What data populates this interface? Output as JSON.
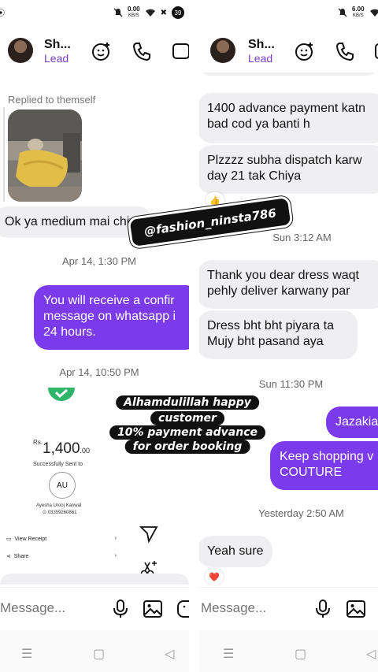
{
  "status": {
    "left_net": {
      "value": "0.00",
      "unit": "KB/S"
    },
    "left_badge": "39",
    "right_net": {
      "value": "6.00",
      "unit": "KB/S"
    }
  },
  "left": {
    "header": {
      "name": "Sh...",
      "label": "Lead"
    },
    "replied_note": "Replied to themself",
    "msg_medium": "Ok ya medium mai chiya",
    "ts1": "Apr 14, 1:30 PM",
    "sent_confirm_lines": [
      "You will receive a confir",
      "message on whatsapp i",
      "24 hours."
    ],
    "ts2": "Apr 14, 10:50 PM",
    "receipt": {
      "currency": "Rs.",
      "amount": "1,400",
      "decimals": ".00",
      "status": "Successfully Sent to",
      "initials": "AU",
      "recipient": "Ayesha Urooj Kanwal",
      "phone": "03359260861",
      "view_receipt": "View Receipt",
      "share": "Share"
    },
    "composer_placeholder": "Message..."
  },
  "right": {
    "header": {
      "name": "Sh...",
      "label": "Lead"
    },
    "msg1": [
      "1400 advance payment katn",
      "bad cod ya banti h"
    ],
    "msg2": [
      "Plzzzz subha dispatch karw",
      "day 21 tak Chiya"
    ],
    "reaction_thumb": "👍",
    "ts1": "Sun 3:12 AM",
    "msg3": [
      "Thank you dear dress waqt",
      "pehly deliver karwany par"
    ],
    "msg4": [
      "Dress bht bht piyara ta",
      "Mujy bht pasand aya"
    ],
    "ts2": "Sun 11:30 PM",
    "sent1": "Jazakia",
    "sent2": [
      "Keep shopping v",
      "COUTURE"
    ],
    "ts3": "Yesterday 2:50 AM",
    "msg5": "Yeah sure",
    "reaction_heart": "❤️",
    "composer_placeholder": "Message..."
  },
  "overlay": {
    "handle": "@fashion_ninsta786",
    "caption": [
      "Alhamdulillah happy",
      "customer",
      "10% payment advance",
      "for order booking"
    ]
  },
  "colors": {
    "accent": "#7c3aed",
    "lead": "#7a3cc7",
    "received_bubble": "#efeff1"
  }
}
